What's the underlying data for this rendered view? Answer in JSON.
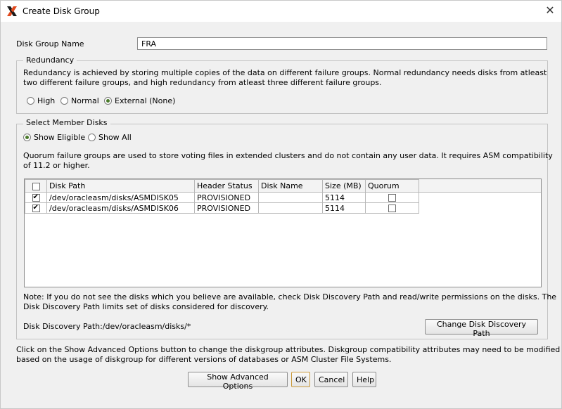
{
  "window": {
    "title": "Create Disk Group",
    "app_icon": "oracle-x-icon",
    "close_icon": "close-icon"
  },
  "disk_group_name": {
    "label": "Disk Group Name",
    "value": "FRA"
  },
  "redundancy": {
    "title": "Redundancy",
    "description_line1": "Redundancy is achieved by storing multiple copies of the data on different failure groups. Normal redundancy needs disks from atleast",
    "description_line2": "two different failure groups, and high redundancy from atleast three different failure groups.",
    "options": [
      {
        "label": "High",
        "selected": false
      },
      {
        "label": "Normal",
        "selected": false
      },
      {
        "label": "External (None)",
        "selected": true
      }
    ]
  },
  "member_disks": {
    "title": "Select Member Disks",
    "filter_options": [
      {
        "label": "Show Eligible",
        "selected": true
      },
      {
        "label": "Show All",
        "selected": false
      }
    ],
    "quorum_note_line1": "Quorum failure groups are used to store voting files in extended clusters and do not contain any user data. It requires ASM compatibility",
    "quorum_note_line2": "of 11.2 or higher.",
    "columns": [
      "",
      "Disk Path",
      "Header Status",
      "Disk Name",
      "Size (MB)",
      "Quorum"
    ],
    "rows": [
      {
        "selected": true,
        "disk_path": "/dev/oracleasm/disks/ASMDISK05",
        "header_status": "PROVISIONED",
        "disk_name": "",
        "size_mb": "5114",
        "quorum": false
      },
      {
        "selected": true,
        "disk_path": "/dev/oracleasm/disks/ASMDISK06",
        "header_status": "PROVISIONED",
        "disk_name": "",
        "size_mb": "5114",
        "quorum": false
      }
    ],
    "discovery_note_line1": "Note: If you do not see the disks which you believe are available, check Disk Discovery Path and read/write permissions on the disks. The",
    "discovery_note_line2": "Disk Discovery Path limits set of disks considered for discovery.",
    "discovery_path": "Disk Discovery Path:/dev/oracleasm/disks/*",
    "change_path_button": "Change Disk Discovery Path"
  },
  "footer": {
    "advanced_note_line1": "Click on the Show Advanced Options button to change the diskgroup attributes. Diskgroup compatibility attributes may need to be modified",
    "advanced_note_line2": "based on the usage of diskgroup for different versions of databases or ASM Cluster File Systems.",
    "buttons": {
      "advanced": "Show Advanced Options",
      "ok": "OK",
      "cancel": "Cancel",
      "help": "Help"
    }
  }
}
